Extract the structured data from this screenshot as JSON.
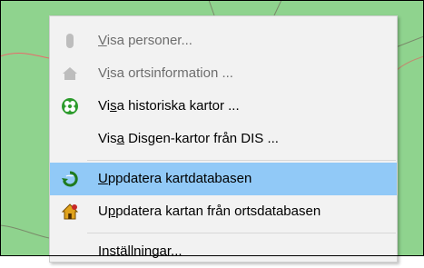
{
  "context_menu": {
    "items": [
      {
        "label": "Visa personer...",
        "acc_index": 0,
        "icon": "person-silhouette-icon",
        "enabled": false,
        "selected": false
      },
      {
        "label": "Visa ortsinformation ...",
        "acc_index": 1,
        "icon": "house-icon",
        "enabled": false,
        "selected": false
      },
      {
        "label": "Visa historiska kartor ...",
        "acc_index": 2,
        "icon": "historic-map-icon",
        "enabled": true,
        "selected": false
      },
      {
        "label": "Visa Disgen-kartor från DIS ...",
        "acc_index": 3,
        "icon": "",
        "enabled": true,
        "selected": false
      },
      {
        "label": "Uppdatera kartdatabasen",
        "acc_index": 0,
        "icon": "map-refresh-icon",
        "enabled": true,
        "selected": true
      },
      {
        "label": "Uppdatera kartan från ortsdatabasen",
        "acc_index": 1,
        "icon": "house-sync-icon",
        "enabled": true,
        "selected": false
      },
      {
        "label": "Inställningar...",
        "acc_index": -1,
        "icon": "",
        "enabled": true,
        "selected": false
      }
    ]
  },
  "colors": {
    "map_green": "#8fd38e",
    "menu_bg": "#f2f2f2",
    "selection": "#91c9f7"
  }
}
